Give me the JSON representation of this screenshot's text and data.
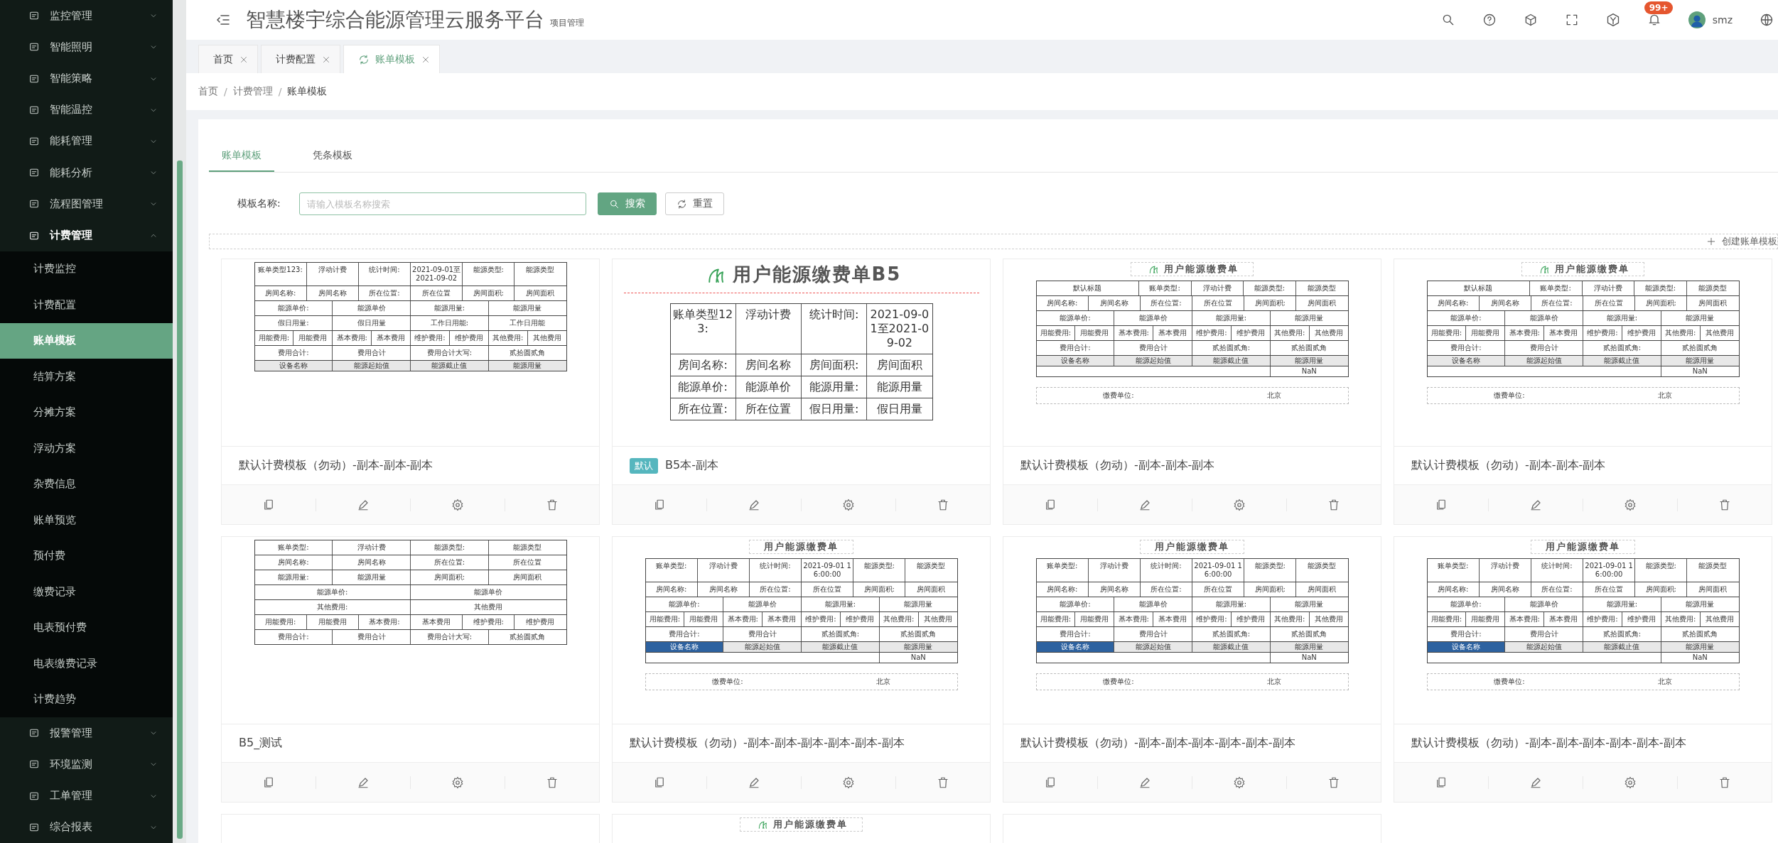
{
  "sidebar": {
    "items": [
      {
        "label": "监控管理",
        "expanded": false
      },
      {
        "label": "智能照明",
        "expanded": false
      },
      {
        "label": "智能策略",
        "expanded": false
      },
      {
        "label": "智能温控",
        "expanded": false
      },
      {
        "label": "能耗管理",
        "expanded": false
      },
      {
        "label": "能耗分析",
        "expanded": false
      },
      {
        "label": "流程图管理",
        "expanded": false
      },
      {
        "label": "计费管理",
        "expanded": true,
        "children": [
          {
            "label": "计费监控",
            "selected": false
          },
          {
            "label": "计费配置",
            "selected": false
          },
          {
            "label": "账单模板",
            "selected": true
          },
          {
            "label": "结算方案",
            "selected": false
          },
          {
            "label": "分摊方案",
            "selected": false
          },
          {
            "label": "浮动方案",
            "selected": false
          },
          {
            "label": "杂费信息",
            "selected": false
          },
          {
            "label": "账单预览",
            "selected": false
          },
          {
            "label": "预付费",
            "selected": false
          },
          {
            "label": "缴费记录",
            "selected": false
          },
          {
            "label": "电表预付费",
            "selected": false
          },
          {
            "label": "电表缴费记录",
            "selected": false
          },
          {
            "label": "计费趋势",
            "selected": false
          }
        ]
      },
      {
        "label": "报警管理",
        "expanded": false
      },
      {
        "label": "环境监测",
        "expanded": false
      },
      {
        "label": "工单管理",
        "expanded": false
      },
      {
        "label": "综合报表",
        "expanded": false
      }
    ]
  },
  "header": {
    "title": "智慧楼宇综合能源管理云服务平台",
    "subtitle": "项目管理",
    "notification_count": "99+",
    "user": "smz"
  },
  "tabs": [
    {
      "label": "首页",
      "selected": false
    },
    {
      "label": "计费配置",
      "selected": false
    },
    {
      "label": "账单模板",
      "selected": true
    }
  ],
  "breadcrumb": {
    "separator": "/",
    "items": [
      "首页",
      "计费管理",
      "账单模板"
    ]
  },
  "content_tabs": [
    {
      "label": "账单模板",
      "selected": true
    },
    {
      "label": "凭条模板",
      "selected": false
    }
  ],
  "search": {
    "label": "模板名称:",
    "placeholder": "请输入模板名称搜索",
    "search_button": "搜索",
    "reset_button": "重置"
  },
  "create_button": "创建账单模板",
  "cards": [
    {
      "name": "默认计费模板（勿动）-副本-副本-副本",
      "preview": {
        "kind": "small",
        "rows": [
          {
            "kind": "fields",
            "fields": [
              {
                "label": "账单类型123:",
                "value": "浮动计费"
              },
              {
                "label": "统计时间:",
                "value": "2021-09-01至2021-09-02"
              },
              {
                "label": "能源类型:",
                "value": "能源类型"
              }
            ]
          },
          {
            "kind": "fields",
            "fields": [
              {
                "label": "房间名称:",
                "value": "房间名称"
              },
              {
                "label": "所在位置:",
                "value": "所在位置"
              },
              {
                "label": "房间面积:",
                "value": "房间面积"
              }
            ]
          },
          {
            "kind": "fields",
            "fields": [
              {
                "label": "能源单价:",
                "value": "能源单价"
              },
              {
                "label": "能源用量:",
                "value": "能源用量"
              }
            ]
          },
          {
            "kind": "fields",
            "fields": [
              {
                "label": "假日用量:",
                "value": "假日用量"
              },
              {
                "label": "工作日用能:",
                "value": "工作日用能"
              }
            ]
          },
          {
            "kind": "fields",
            "fields": [
              {
                "label": "用能费用:",
                "value": "用能费用"
              },
              {
                "label": "基本费用:",
                "value": "基本费用"
              },
              {
                "label": "维护费用:",
                "value": "维护费用"
              },
              {
                "label": "其他费用:",
                "value": "其他费用"
              }
            ]
          },
          {
            "kind": "fields",
            "fields": [
              {
                "label": "费用合计:",
                "value": "费用合计"
              },
              {
                "label": "费用合计大写:",
                "value": "贰拾圆贰角"
              }
            ]
          },
          {
            "kind": "header",
            "columns": [
              "设备名称",
              "能源起始值",
              "能源截止值",
              "能源用量"
            ]
          }
        ]
      }
    },
    {
      "name": "B5本-副本",
      "badge": "默认",
      "preview": {
        "kind": "large",
        "logo": true,
        "title": "用户能源缴费单B5",
        "rows": [
          {
            "kind": "fields",
            "fields": [
              {
                "label": "账单类型123:",
                "value": "浮动计费"
              },
              {
                "label": "统计时间:",
                "value": "2021-09-01至2021-09-02"
              }
            ]
          },
          {
            "kind": "fields",
            "fields": [
              {
                "label": "房间名称:",
                "value": "房间名称"
              },
              {
                "label": "房间面积:",
                "value": "房间面积"
              }
            ]
          },
          {
            "kind": "fields",
            "fields": [
              {
                "label": "能源单价:",
                "value": "能源单价"
              },
              {
                "label": "能源用量:",
                "value": "能源用量"
              }
            ]
          },
          {
            "kind": "fields",
            "fields": [
              {
                "label": "所在位置:",
                "value": "所在位置"
              },
              {
                "label": "假日用量:",
                "value": "假日用量"
              }
            ]
          }
        ]
      }
    },
    {
      "name": "默认计费模板（勿动）-副本-副本-副本",
      "preview": {
        "kind": "small",
        "logo": true,
        "title": "用户能源缴费单",
        "rows": [
          {
            "kind": "fields",
            "title": "默认标题",
            "fields": [
              {
                "label": "账单类型:",
                "value": "浮动计费"
              },
              {
                "label": "能源类型:",
                "value": "能源类型"
              }
            ]
          },
          {
            "kind": "fields",
            "fields": [
              {
                "label": "房间名称:",
                "value": "房间名称"
              },
              {
                "label": "所在位置:",
                "value": "所在位置"
              },
              {
                "label": "房间面积:",
                "value": "房间面积"
              }
            ]
          },
          {
            "kind": "fields",
            "fields": [
              {
                "label": "能源单价:",
                "value": "能源单价"
              },
              {
                "label": "能源用量:",
                "value": "能源用量"
              }
            ]
          },
          {
            "kind": "fields",
            "fields": [
              {
                "label": "用能费用:",
                "value": "用能费用"
              },
              {
                "label": "基本费用:",
                "value": "基本费用"
              },
              {
                "label": "维护费用:",
                "value": "维护费用"
              },
              {
                "label": "其他费用:",
                "value": "其他费用"
              }
            ]
          },
          {
            "kind": "fields",
            "fields": [
              {
                "label": "费用合计:",
                "value": "费用合计"
              },
              {
                "label": "贰拾圆贰角:",
                "value": "贰拾圆贰角"
              }
            ]
          },
          {
            "kind": "header",
            "columns": [
              "设备名称",
              "能源起始值",
              "能源截止值",
              "能源用量"
            ]
          },
          {
            "kind": "value",
            "value": "NaN"
          },
          {
            "kind": "footer",
            "fields": [
              {
                "label": "缴费单位:",
                "value": "北京"
              }
            ]
          }
        ]
      }
    },
    {
      "name": "默认计费模板（勿动）-副本-副本-副本",
      "preview": {
        "kind": "small",
        "logo": true,
        "title": "用户能源缴费单",
        "rows": [
          {
            "kind": "fields",
            "title": "默认标题",
            "fields": [
              {
                "label": "账单类型:",
                "value": "浮动计费"
              },
              {
                "label": "能源类型:",
                "value": "能源类型"
              }
            ]
          },
          {
            "kind": "fields",
            "fields": [
              {
                "label": "房间名称:",
                "value": "房间名称"
              },
              {
                "label": "所在位置:",
                "value": "所在位置"
              },
              {
                "label": "房间面积:",
                "value": "房间面积"
              }
            ]
          },
          {
            "kind": "fields",
            "fields": [
              {
                "label": "能源单价:",
                "value": "能源单价"
              },
              {
                "label": "能源用量:",
                "value": "能源用量"
              }
            ]
          },
          {
            "kind": "fields",
            "fields": [
              {
                "label": "用能费用:",
                "value": "用能费用"
              },
              {
                "label": "基本费用:",
                "value": "基本费用"
              },
              {
                "label": "维护费用:",
                "value": "维护费用"
              },
              {
                "label": "其他费用:",
                "value": "其他费用"
              }
            ]
          },
          {
            "kind": "fields",
            "fields": [
              {
                "label": "费用合计:",
                "value": "费用合计"
              },
              {
                "label": "贰拾圆贰角:",
                "value": "贰拾圆贰角"
              }
            ]
          },
          {
            "kind": "header",
            "columns": [
              "设备名称",
              "能源起始值",
              "能源截止值",
              "能源用量"
            ]
          },
          {
            "kind": "value",
            "value": "NaN"
          },
          {
            "kind": "footer",
            "fields": [
              {
                "label": "缴费单位:",
                "value": "北京"
              }
            ]
          }
        ]
      }
    },
    {
      "name": "B5_测试",
      "preview": {
        "kind": "small",
        "rows": [
          {
            "kind": "fields",
            "fields": [
              {
                "label": "账单类型:",
                "value": "浮动计费"
              },
              {
                "label": "能源类型:",
                "value": "能源类型"
              }
            ]
          },
          {
            "kind": "fields",
            "fields": [
              {
                "label": "房间名称:",
                "value": "房间名称"
              },
              {
                "label": "所在位置:",
                "value": "所在位置"
              }
            ]
          },
          {
            "kind": "fields",
            "fields": [
              {
                "label": "能源用量:",
                "value": "能源用量"
              },
              {
                "label": "房间面积:",
                "value": "房间面积"
              }
            ]
          },
          {
            "kind": "fields",
            "fields": [
              {
                "label": "能源单价:",
                "value": "能源单价"
              }
            ]
          },
          {
            "kind": "fields",
            "fields": [
              {
                "label": "其他费用:",
                "value": "其他费用"
              }
            ]
          },
          {
            "kind": "fields",
            "fields": [
              {
                "label": "用能费用:",
                "value": "用能费用"
              },
              {
                "label": "基本费用:",
                "value": "基本费用"
              },
              {
                "label": "维护费用:",
                "value": "维护费用"
              }
            ]
          },
          {
            "kind": "fields",
            "fields": [
              {
                "label": "费用合计:",
                "value": "费用合计"
              },
              {
                "label": "费用合计大写:",
                "value": "贰拾圆贰角"
              }
            ]
          }
        ]
      }
    },
    {
      "name": "默认计费模板（勿动）-副本-副本-副本-副本-副本-副本",
      "preview": {
        "kind": "small",
        "title": "用户能源缴费单",
        "rows": [
          {
            "kind": "fields",
            "fields": [
              {
                "label": "账单类型:",
                "value": "浮动计费"
              },
              {
                "label": "统计时间:",
                "value": "2021-09-01 16:00:00"
              },
              {
                "label": "能源类型:",
                "value": "能源类型"
              }
            ]
          },
          {
            "kind": "fields",
            "fields": [
              {
                "label": "房间名称:",
                "value": "房间名称"
              },
              {
                "label": "所在位置:",
                "value": "所在位置"
              },
              {
                "label": "房间面积:",
                "value": "房间面积"
              }
            ]
          },
          {
            "kind": "fields",
            "fields": [
              {
                "label": "能源单价:",
                "value": "能源单价"
              },
              {
                "label": "能源用量:",
                "value": "能源用量"
              }
            ]
          },
          {
            "kind": "fields",
            "fields": [
              {
                "label": "用能费用:",
                "value": "用能费用"
              },
              {
                "label": "基本费用:",
                "value": "基本费用"
              },
              {
                "label": "维护费用:",
                "value": "维护费用"
              },
              {
                "label": "其他费用:",
                "value": "其他费用"
              }
            ]
          },
          {
            "kind": "fields",
            "fields": [
              {
                "label": "费用合计:",
                "value": "费用合计"
              },
              {
                "label": "贰拾圆贰角:",
                "value": "贰拾圆贰角"
              }
            ]
          },
          {
            "kind": "header_blue",
            "columns": [
              "设备名称",
              "能源起始值",
              "能源截止值",
              "能源用量"
            ]
          },
          {
            "kind": "value",
            "value": "NaN"
          },
          {
            "kind": "footer",
            "fields": [
              {
                "label": "缴费单位:",
                "value": "北京"
              }
            ]
          }
        ]
      }
    },
    {
      "name": "默认计费模板（勿动）-副本-副本-副本-副本-副本-副本",
      "preview": {
        "kind": "small",
        "title": "用户能源缴费单",
        "rows": [
          {
            "kind": "fields",
            "fields": [
              {
                "label": "账单类型:",
                "value": "浮动计费"
              },
              {
                "label": "统计时间:",
                "value": "2021-09-01 16:00:00"
              },
              {
                "label": "能源类型:",
                "value": "能源类型"
              }
            ]
          },
          {
            "kind": "fields",
            "fields": [
              {
                "label": "房间名称:",
                "value": "房间名称"
              },
              {
                "label": "所在位置:",
                "value": "所在位置"
              },
              {
                "label": "房间面积:",
                "value": "房间面积"
              }
            ]
          },
          {
            "kind": "fields",
            "fields": [
              {
                "label": "能源单价:",
                "value": "能源单价"
              },
              {
                "label": "能源用量:",
                "value": "能源用量"
              }
            ]
          },
          {
            "kind": "fields",
            "fields": [
              {
                "label": "用能费用:",
                "value": "用能费用"
              },
              {
                "label": "基本费用:",
                "value": "基本费用"
              },
              {
                "label": "维护费用:",
                "value": "维护费用"
              },
              {
                "label": "其他费用:",
                "value": "其他费用"
              }
            ]
          },
          {
            "kind": "fields",
            "fields": [
              {
                "label": "费用合计:",
                "value": "费用合计"
              },
              {
                "label": "贰拾圆贰角:",
                "value": "贰拾圆贰角"
              }
            ]
          },
          {
            "kind": "header_blue",
            "columns": [
              "设备名称",
              "能源起始值",
              "能源截止值",
              "能源用量"
            ]
          },
          {
            "kind": "value",
            "value": "NaN"
          },
          {
            "kind": "footer",
            "fields": [
              {
                "label": "缴费单位:",
                "value": "北京"
              }
            ]
          }
        ]
      }
    },
    {
      "name": "默认计费模板（勿动）-副本-副本-副本-副本-副本-副本",
      "preview": {
        "kind": "small",
        "title": "用户能源缴费单",
        "rows": [
          {
            "kind": "fields",
            "fields": [
              {
                "label": "账单类型:",
                "value": "浮动计费"
              },
              {
                "label": "统计时间:",
                "value": "2021-09-01 16:00:00"
              },
              {
                "label": "能源类型:",
                "value": "能源类型"
              }
            ]
          },
          {
            "kind": "fields",
            "fields": [
              {
                "label": "房间名称:",
                "value": "房间名称"
              },
              {
                "label": "所在位置:",
                "value": "所在位置"
              },
              {
                "label": "房间面积:",
                "value": "房间面积"
              }
            ]
          },
          {
            "kind": "fields",
            "fields": [
              {
                "label": "能源单价:",
                "value": "能源单价"
              },
              {
                "label": "能源用量:",
                "value": "能源用量"
              }
            ]
          },
          {
            "kind": "fields",
            "fields": [
              {
                "label": "用能费用:",
                "value": "用能费用"
              },
              {
                "label": "基本费用:",
                "value": "基本费用"
              },
              {
                "label": "维护费用:",
                "value": "维护费用"
              },
              {
                "label": "其他费用:",
                "value": "其他费用"
              }
            ]
          },
          {
            "kind": "fields",
            "fields": [
              {
                "label": "费用合计:",
                "value": "费用合计"
              },
              {
                "label": "贰拾圆贰角:",
                "value": "贰拾圆贰角"
              }
            ]
          },
          {
            "kind": "header_blue",
            "columns": [
              "设备名称",
              "能源起始值",
              "能源截止值",
              "能源用量"
            ]
          },
          {
            "kind": "value",
            "value": "NaN"
          },
          {
            "kind": "footer",
            "fields": [
              {
                "label": "缴费单位:",
                "value": "北京"
              }
            ]
          }
        ]
      }
    },
    {
      "preview": {
        "kind": "small"
      }
    },
    {
      "preview": {
        "kind": "small",
        "logo": true,
        "title": "用户能源缴费单"
      }
    },
    {
      "preview": {
        "kind": "small"
      }
    }
  ]
}
